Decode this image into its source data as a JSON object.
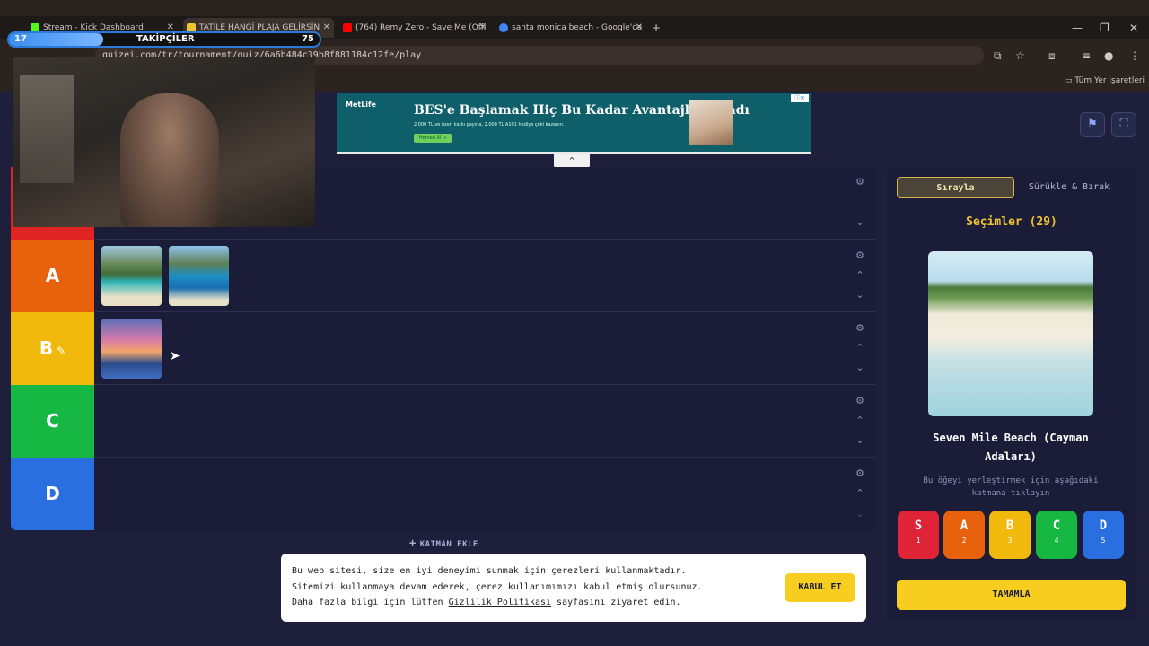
{
  "browser": {
    "tabs": [
      {
        "title": "Stream - Kick Dashboard",
        "color": "#53fc18"
      },
      {
        "title": "TATİLE HANGİ PLAJA GELİRSİN",
        "color": "#f1c232"
      },
      {
        "title": "(764) Remy Zero - Save Me (Offi",
        "color": "#ff0000"
      },
      {
        "title": "santa monica beach - Google'da",
        "color": "#4285f4"
      }
    ],
    "url": "quizei.com/tr/tournament/quiz/6a6b484c39b8f881184c12fe/play",
    "bookmarks_label": "Tüm Yer İşaretleri"
  },
  "ad": {
    "brand": "MetLife",
    "headline": "BES'e Başlamak Hiç Bu Kadar Avantajlı Olmadı",
    "sub": "2.000 TL ve üzeri katkı payına, 2.000 TL A101 hediye çeki kazanın.",
    "cta": "Hemen Al →"
  },
  "tiers": [
    {
      "label": "",
      "color": "#e02424"
    },
    {
      "label": "A",
      "color": "#e8610c"
    },
    {
      "label": "B",
      "color": "#f0b90b"
    },
    {
      "label": "C",
      "color": "#16b843"
    },
    {
      "label": "D",
      "color": "#2a6fe0"
    }
  ],
  "add_layer": "KATMAN EKLE",
  "panel": {
    "mode_order": "Sırayla",
    "mode_drag": "Sürükle & Bırak",
    "choices_title": "Seçimler (29)",
    "item_name": "Seven Mile Beach (Cayman Adaları)",
    "hint": "Bu öğeyi yerleştirmek için aşağıdaki katmana tıklayın",
    "picks": [
      {
        "letter": "S",
        "num": "1",
        "color": "#e02437"
      },
      {
        "letter": "A",
        "num": "2",
        "color": "#e8610c"
      },
      {
        "letter": "B",
        "num": "3",
        "color": "#f0b90b"
      },
      {
        "letter": "C",
        "num": "4",
        "color": "#16b843"
      },
      {
        "letter": "D",
        "num": "5",
        "color": "#2a6fe0"
      }
    ],
    "finish": "TAMAMLA"
  },
  "cookie": {
    "line1": "Bu web sitesi, size en iyi deneyimi sunmak için çerezleri kullanmaktadır.",
    "line2": "Sitemizi kullanmaya devam ederek, çerez kullanımımızı kabul etmiş olursunuz.",
    "line3_pre": "Daha fazla bilgi için lütfen",
    "line3_link": "Gizlilik Politikası",
    "line3_post": "sayfasını ziyaret edin.",
    "accept": "KABUL ET"
  },
  "overlay": {
    "follow_current": "17",
    "follow_label": "TAKİPÇİLER",
    "follow_goal": "75"
  }
}
